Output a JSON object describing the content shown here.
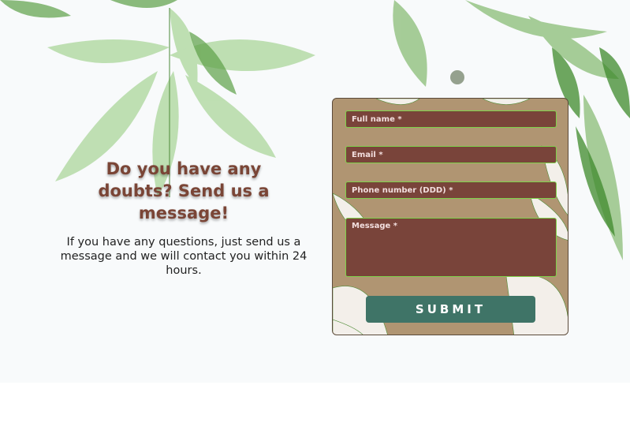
{
  "hero": {
    "headline": "Do you have any doubts? Send us a message!",
    "subtext": "If you have any questions, just send us a message and we will contact you within 24 hours."
  },
  "form": {
    "fields": [
      {
        "label": "Full name *"
      },
      {
        "label": "Email *"
      },
      {
        "label": "Phone number (DDD) *"
      },
      {
        "label": "Message *"
      }
    ],
    "submit_label": "SUBMIT"
  },
  "colors": {
    "headline": "#7a4536",
    "field_bg": "#79443a",
    "field_border": "#7ed24a",
    "button_bg": "#3f7467",
    "card_bg": "#b09572"
  },
  "icons": [
    "leaf-decoration",
    "leaf-line-art"
  ]
}
